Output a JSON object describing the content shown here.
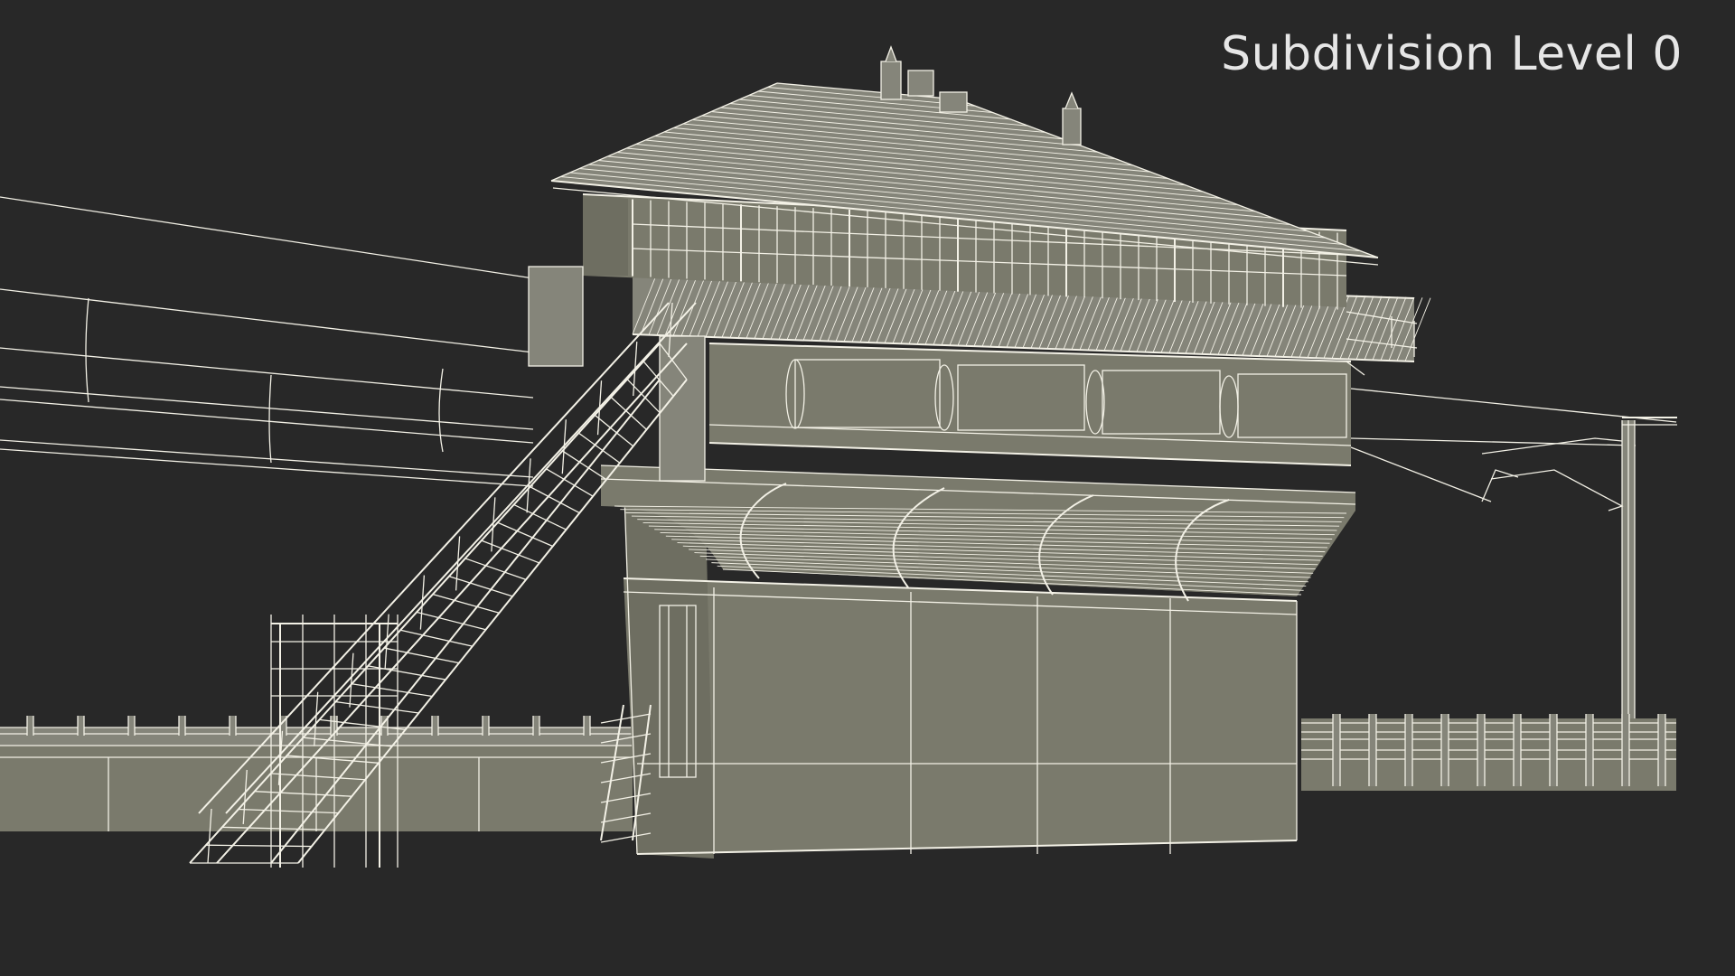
{
  "viewport": {
    "overlay_label": "Subdivision Level 0",
    "background_color": "#282828",
    "model_surface_color": "#7a7a6c",
    "wireframe_color": "#f3f1e6"
  },
  "scene": {
    "subject": "railway-signal-box",
    "render_mode": "wireframe-over-shaded",
    "parts": [
      "signal-box-tower",
      "hipped-roof",
      "chimneys",
      "windows",
      "lower-stair",
      "upper-stair",
      "platform-railing-left",
      "platform-railing-right",
      "overhead-wires",
      "catenary-mast"
    ]
  }
}
